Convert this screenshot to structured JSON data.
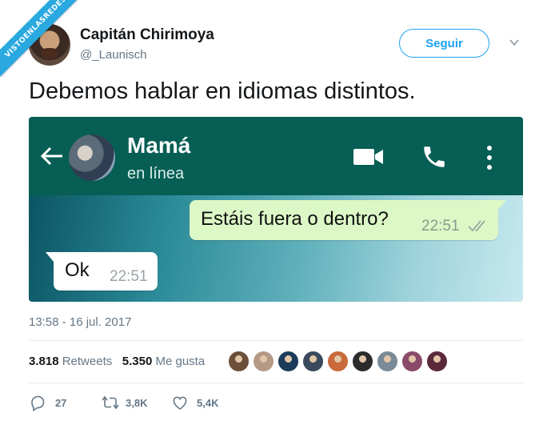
{
  "watermark": "VISTOENLASREDES",
  "tweet": {
    "author_name": "Capitán Chirimoya",
    "author_handle": "@_Launisch",
    "follow_label": "Seguir",
    "text": "Debemos hablar en idiomas distintos.",
    "timestamp": "13:58 - 16 jul. 2017",
    "retweets_count": "3.818",
    "retweets_label": "Retweets",
    "likes_count": "5.350",
    "likes_label": "Me gusta",
    "reply_count": "27",
    "retweet_action_count": "3,8K",
    "like_action_count": "5,4K"
  },
  "whatsapp": {
    "contact_name": "Mamá",
    "status": "en línea",
    "outgoing": {
      "text": "Estáis fuera o dentro?",
      "time": "22:51"
    },
    "incoming": {
      "text": "Ok",
      "time": "22:51"
    }
  },
  "likers": [
    {
      "icon": "avatar-1",
      "color": "#6b4f3a"
    },
    {
      "icon": "avatar-2",
      "color": "#b59a86"
    },
    {
      "icon": "avatar-3",
      "color": "#1c3b5a"
    },
    {
      "icon": "avatar-4",
      "color": "#3a4a5c"
    },
    {
      "icon": "avatar-5",
      "color": "#c86a3a"
    },
    {
      "icon": "avatar-6",
      "color": "#2b2b2b"
    },
    {
      "icon": "avatar-7",
      "color": "#7a8a96"
    },
    {
      "icon": "avatar-8",
      "color": "#8a4a6a"
    },
    {
      "icon": "avatar-9",
      "color": "#5a2a3a"
    }
  ],
  "colors": {
    "twitter_blue": "#1da1f2",
    "whatsapp_green": "#075e54",
    "bubble_out": "#dcf8c6",
    "text_gray": "#657786"
  }
}
